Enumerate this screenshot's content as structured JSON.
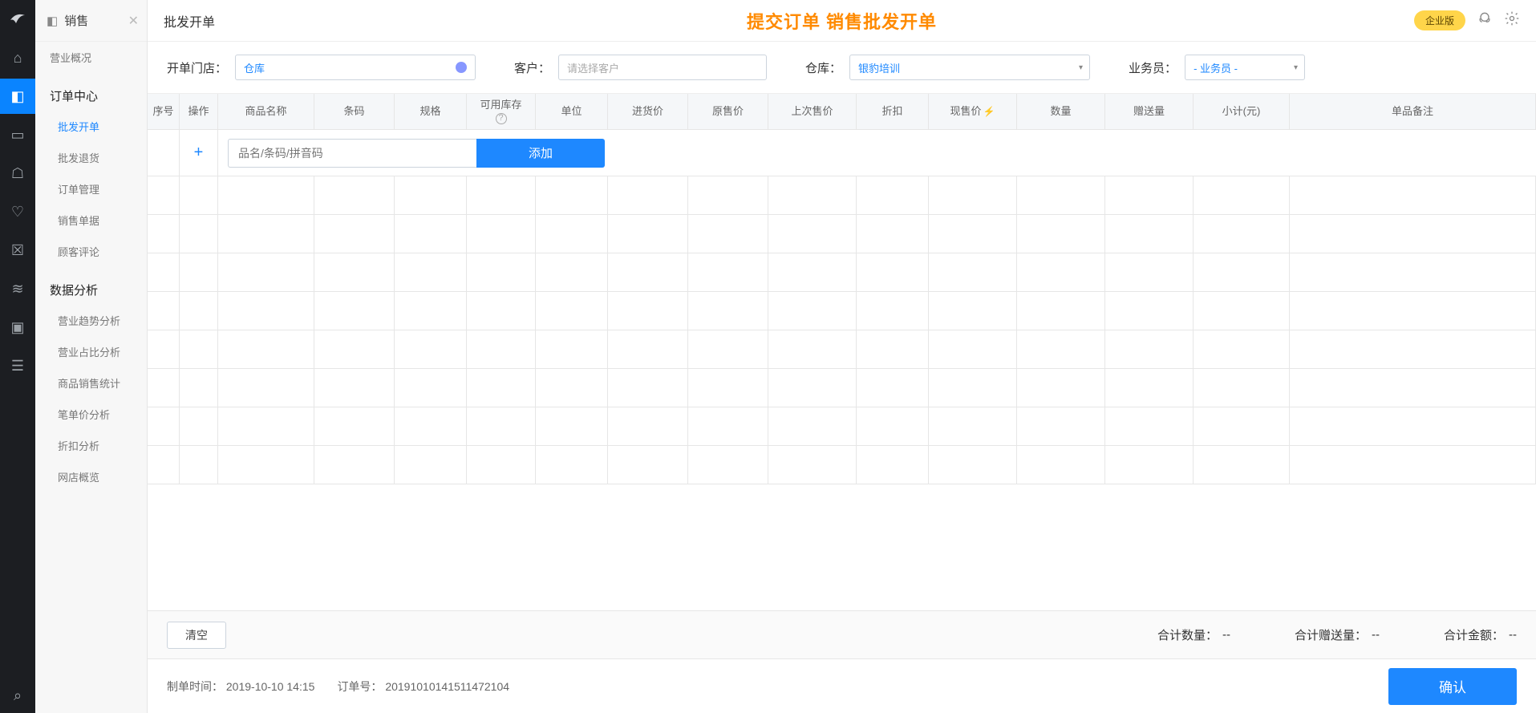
{
  "rail": {
    "items": [
      "home",
      "sales",
      "store",
      "user",
      "favorite",
      "box",
      "chart",
      "screen",
      "filter"
    ],
    "bottom": "search"
  },
  "sidebar": {
    "title": "销售",
    "groups": [
      {
        "label": "营业概况",
        "items": []
      },
      {
        "label": "订单中心",
        "items": [
          "批发开单",
          "批发退货",
          "订单管理",
          "销售单据",
          "顾客评论"
        ],
        "activeIndex": 0
      },
      {
        "label": "数据分析",
        "items": [
          "营业趋势分析",
          "营业占比分析",
          "商品销售统计",
          "笔单价分析",
          "折扣分析",
          "网店概览"
        ],
        "activeIndex": -1
      }
    ]
  },
  "topbar": {
    "pageTitle": "批发开单",
    "centerTitle": "提交订单 销售批发开单",
    "enterpriseBadge": "企业版"
  },
  "filters": {
    "storeLabel": "开单门店：",
    "storeValue": "仓库",
    "customerLabel": "客户：",
    "customerPlaceholder": "请选择客户",
    "warehouseLabel": "仓库：",
    "warehouseValue": "银豹培训",
    "salesmanLabel": "业务员：",
    "salesmanValue": "- 业务员 -"
  },
  "table": {
    "headers": {
      "seq": "序号",
      "op": "操作",
      "name": "商品名称",
      "code": "条码",
      "spec": "规格",
      "stock": "可用库存",
      "unit": "单位",
      "buy": "进货价",
      "orig": "原售价",
      "last": "上次售价",
      "disc": "折扣",
      "now": "现售价",
      "qty": "数量",
      "gift": "赠送量",
      "sub": "小计(元)",
      "note": "单品备注"
    },
    "searchPlaceholder": "品名/条码/拼音码",
    "addBtn": "添加",
    "emptyRows": 8
  },
  "summary": {
    "clearBtn": "清空",
    "totalQtyLabel": "合计数量：",
    "totalQtyValue": "--",
    "totalGiftLabel": "合计赠送量：",
    "totalGiftValue": "--",
    "totalAmtLabel": "合计金额：",
    "totalAmtValue": "--"
  },
  "footer": {
    "createTimeLabel": "制单时间：",
    "createTimeValue": "2019-10-10 14:15",
    "orderNoLabel": "订单号：",
    "orderNoValue": "20191010141511472104",
    "confirmBtn": "确认"
  }
}
